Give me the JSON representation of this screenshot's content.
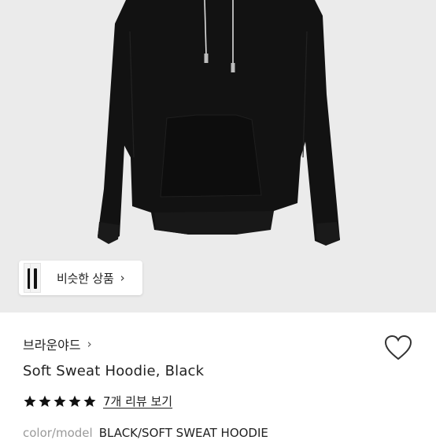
{
  "product_image": {
    "background_color": "#ebebeb",
    "garment_color": "#111111"
  },
  "similar_button": {
    "label": "비슷한 상품",
    "chevron": "›"
  },
  "brand": {
    "name": "브라운야드",
    "chevron": "›"
  },
  "wishlist": {
    "icon": "heart-outline-icon"
  },
  "product": {
    "title": "Soft Sweat Hoodie, Black"
  },
  "rating": {
    "stars": 5,
    "max": 5,
    "review_link": "7개 리뷰 보기"
  },
  "meta": {
    "label": "color/model",
    "value": "BLACK/SOFT SWEAT HOODIE"
  }
}
